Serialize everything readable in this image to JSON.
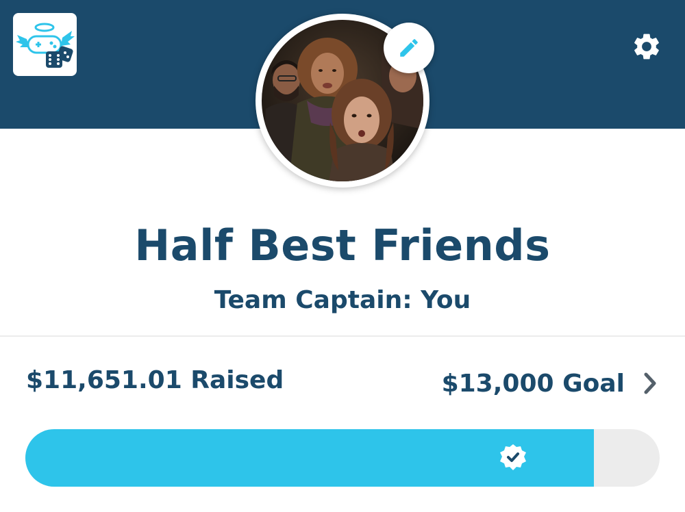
{
  "header": {
    "logo_icon": "angel-gamepad-dice-logo-icon",
    "settings_icon": "gear-icon",
    "edit_icon": "pencil-icon",
    "band_color": "#1b4a6b"
  },
  "team": {
    "name": "Half Best Friends",
    "captain": "Team Captain: You"
  },
  "fundraising": {
    "raised_label": "$11,651.01 Raised",
    "goal_label": "$13,000 Goal",
    "raised_amount": 11651.01,
    "goal_amount": 13000,
    "progress_fraction": 0.8962,
    "chevron_icon": "chevron-right-icon",
    "badge_icon": "verified-check-badge-icon",
    "fill_color": "#2ec4ea",
    "track_color": "#ececec"
  }
}
